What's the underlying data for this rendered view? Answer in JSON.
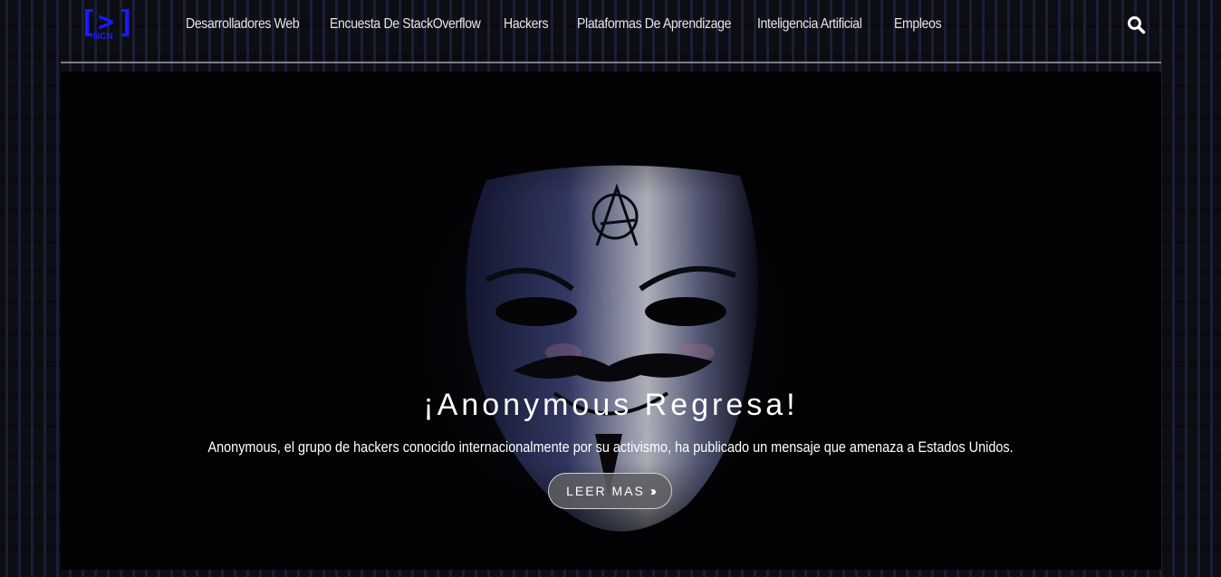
{
  "header": {
    "logo": {
      "symbol_left": "[",
      "symbol_mid": ">",
      "symbol_right": "]",
      "sub_text": "NCN",
      "color": "#1a1aff"
    },
    "nav_items": [
      {
        "label": "Desarrolladores Web"
      },
      {
        "label": "Encuesta De StackOverflow"
      },
      {
        "label": "Hackers"
      },
      {
        "label": "Plataformas De Aprendizage"
      },
      {
        "label": "Inteligencia Artificial"
      },
      {
        "label": "Empleos"
      }
    ],
    "search_icon": "search-icon"
  },
  "hero": {
    "title": "¡Anonymous Regresa!",
    "description": "Anonymous, el grupo de hackers conocido internacionalmente por su activismo, ha publicado un mensaje que amenaza a Estados Unidos.",
    "button_label": "LEER MAS",
    "button_icon": "double-chevron-right-icon",
    "image": "guy-fawkes-mask"
  }
}
